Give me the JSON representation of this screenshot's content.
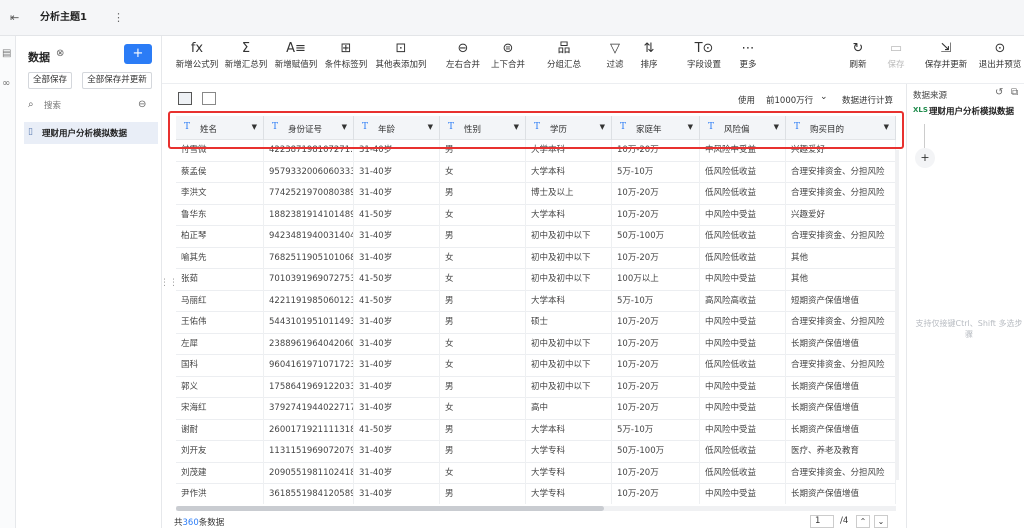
{
  "topbar": {
    "back_icon": "exit-icon",
    "tab_title": "分析主题1",
    "more_icon": "more-vertical-icon"
  },
  "sidebar": {
    "title": "数据",
    "add_label": "+",
    "save_all": "全部保存",
    "save_all_update": "全部保存并更新",
    "search_placeholder": "搜索",
    "dataset": "理财用户分析模拟数据"
  },
  "toolbar": {
    "tools": [
      {
        "icon": "fx",
        "label": "新增公式列"
      },
      {
        "icon": "Σ",
        "label": "新增汇总列"
      },
      {
        "icon": "A≡",
        "label": "新增赋值列"
      },
      {
        "icon": "⊞",
        "label": "条件标签列"
      },
      {
        "icon": "⊡",
        "label": "其他表添加列"
      },
      {
        "icon": "⊖",
        "label": "左右合并"
      },
      {
        "icon": "⊜",
        "label": "上下合并"
      },
      {
        "icon": "品",
        "label": "分组汇总"
      },
      {
        "icon": "▽",
        "label": "过滤"
      },
      {
        "icon": "⇅",
        "label": "排序"
      },
      {
        "icon": "T⊙",
        "label": "字段设置"
      },
      {
        "icon": "⋯",
        "label": "更多"
      },
      {
        "icon": "↻",
        "label": "刷新"
      },
      {
        "icon": "▭",
        "label": "保存"
      },
      {
        "icon": "⇲",
        "label": "保存并更新"
      },
      {
        "icon": "⊙",
        "label": "退出并预览"
      }
    ]
  },
  "viewbar": {
    "use": "使用",
    "rows": "前1000万行",
    "calc": "数据进行计算"
  },
  "grid": {
    "columns": [
      "姓名",
      "身份证号",
      "年龄",
      "性别",
      "学历",
      "家庭年",
      "风险偏",
      "购买目的"
    ],
    "rows": [
      [
        "付雪微",
        "42238719810727​1...",
        "31-40岁",
        "男",
        "大学本科",
        "10万-20万",
        "中风险中受益",
        "兴趣爱好"
      ],
      [
        "蔡孟侯",
        "9579332006060333...",
        "31-40岁",
        "女",
        "大学本科",
        "5万-10万",
        "低风险低收益",
        "合理安排资金、分担风险"
      ],
      [
        "李洪文",
        "7742521970080389...",
        "31-40岁",
        "男",
        "博士及以上",
        "10万-20万",
        "低风险低收益",
        "合理安排资金、分担风险"
      ],
      [
        "鲁华东",
        "1882381914101489...",
        "41-50岁",
        "女",
        "大学本科",
        "10万-20万",
        "中风险中受益",
        "兴趣爱好"
      ],
      [
        "柏正琴",
        "9423481940031404...",
        "31-40岁",
        "男",
        "初中及初中以下",
        "50万-100万",
        "低风险低收益",
        "合理安排资金、分担风险"
      ],
      [
        "喻其先",
        "7682511905101068...",
        "31-40岁",
        "女",
        "初中及初中以下",
        "10万-20万",
        "低风险低收益",
        "其他"
      ],
      [
        "张茹",
        "7010391969072753...",
        "41-50岁",
        "女",
        "初中及初中以下",
        "100万以上",
        "中风险中受益",
        "其他"
      ],
      [
        "马丽红",
        "4221191985060123...",
        "41-50岁",
        "男",
        "大学本科",
        "5万-10万",
        "高风险高收益",
        "短期资产保值增值"
      ],
      [
        "王佑伟",
        "5443101951011493...",
        "31-40岁",
        "男",
        "硕士",
        "10万-20万",
        "中风险中受益",
        "合理安排资金、分担风险"
      ],
      [
        "左犀",
        "2388961964042060...",
        "31-40岁",
        "女",
        "初中及初中以下",
        "10万-20万",
        "中风险中受益",
        "长期资产保值增值"
      ],
      [
        "国科",
        "9604161971071723...",
        "31-40岁",
        "女",
        "初中及初中以下",
        "10万-20万",
        "低风险低收益",
        "合理安排资金、分担风险"
      ],
      [
        "郭义",
        "1758641969122033...",
        "31-40岁",
        "男",
        "初中及初中以下",
        "10万-20万",
        "中风险中受益",
        "长期资产保值增值"
      ],
      [
        "宋海红",
        "3792741944022717...",
        "31-40岁",
        "女",
        "高中",
        "10万-20万",
        "中风险中受益",
        "长期资产保值增值"
      ],
      [
        "谢耐",
        "2600171921111318​98",
        "41-50岁",
        "男",
        "大学本科",
        "5万-10万",
        "中风险中受益",
        "长期资产保值增值"
      ],
      [
        "刘开友",
        "1131151969072079​98",
        "31-40岁",
        "男",
        "大学专科",
        "50万-100万",
        "低风险低收益",
        "医疗、养老及教育"
      ],
      [
        "刘茂建",
        "2090551981102418...",
        "31-40岁",
        "女",
        "大学专科",
        "10万-20万",
        "低风险低收益",
        "合理安排资金、分担风险"
      ],
      [
        "尹作洪",
        "3618551984120589...",
        "31-40岁",
        "男",
        "大学专科",
        "10万-20万",
        "中风险中受益",
        "长期资产保值增值"
      ]
    ]
  },
  "footer": {
    "total_prefix": "共",
    "total_count": "360",
    "total_suffix": "条数据",
    "page": "1",
    "page_of": "/4"
  },
  "rpanel": {
    "title": "数据来源",
    "xls": "XLS",
    "source": "理财用户分析模拟数据",
    "hint": "支持仅接键Ctrl、Shift 多选步骤"
  },
  "colors": {
    "accent": "#2b7cf6",
    "highlight": "#e8312f"
  }
}
